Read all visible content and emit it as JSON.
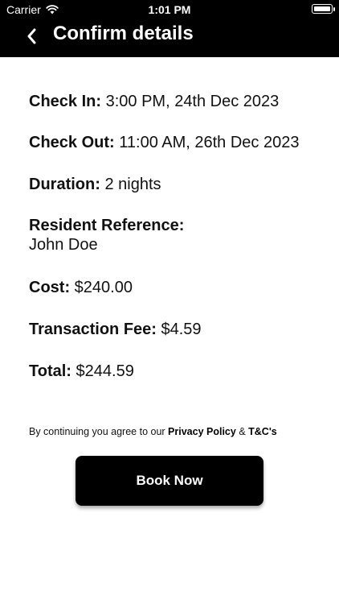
{
  "status_bar": {
    "carrier": "Carrier",
    "time": "1:01 PM"
  },
  "header": {
    "title": "Confirm details"
  },
  "details": [
    {
      "label": "Check In:",
      "value": "3:00 PM, 24th Dec 2023"
    },
    {
      "label": "Check Out:",
      "value": "11:00 AM, 26th Dec 2023"
    },
    {
      "label": "Duration:",
      "value": "2 nights"
    },
    {
      "label": "Resident Reference:",
      "value": "John Doe"
    },
    {
      "label": "Cost:",
      "value": "$240.00"
    },
    {
      "label": "Transaction Fee:",
      "value": "$4.59"
    },
    {
      "label": "Total:",
      "value": "$244.59"
    }
  ],
  "terms": {
    "prefix": "By continuing you agree to our",
    "privacy_link": "Privacy Policy",
    "ampersand": "&",
    "tc_link": "T&C's"
  },
  "book_button": {
    "label": "Book Now"
  }
}
